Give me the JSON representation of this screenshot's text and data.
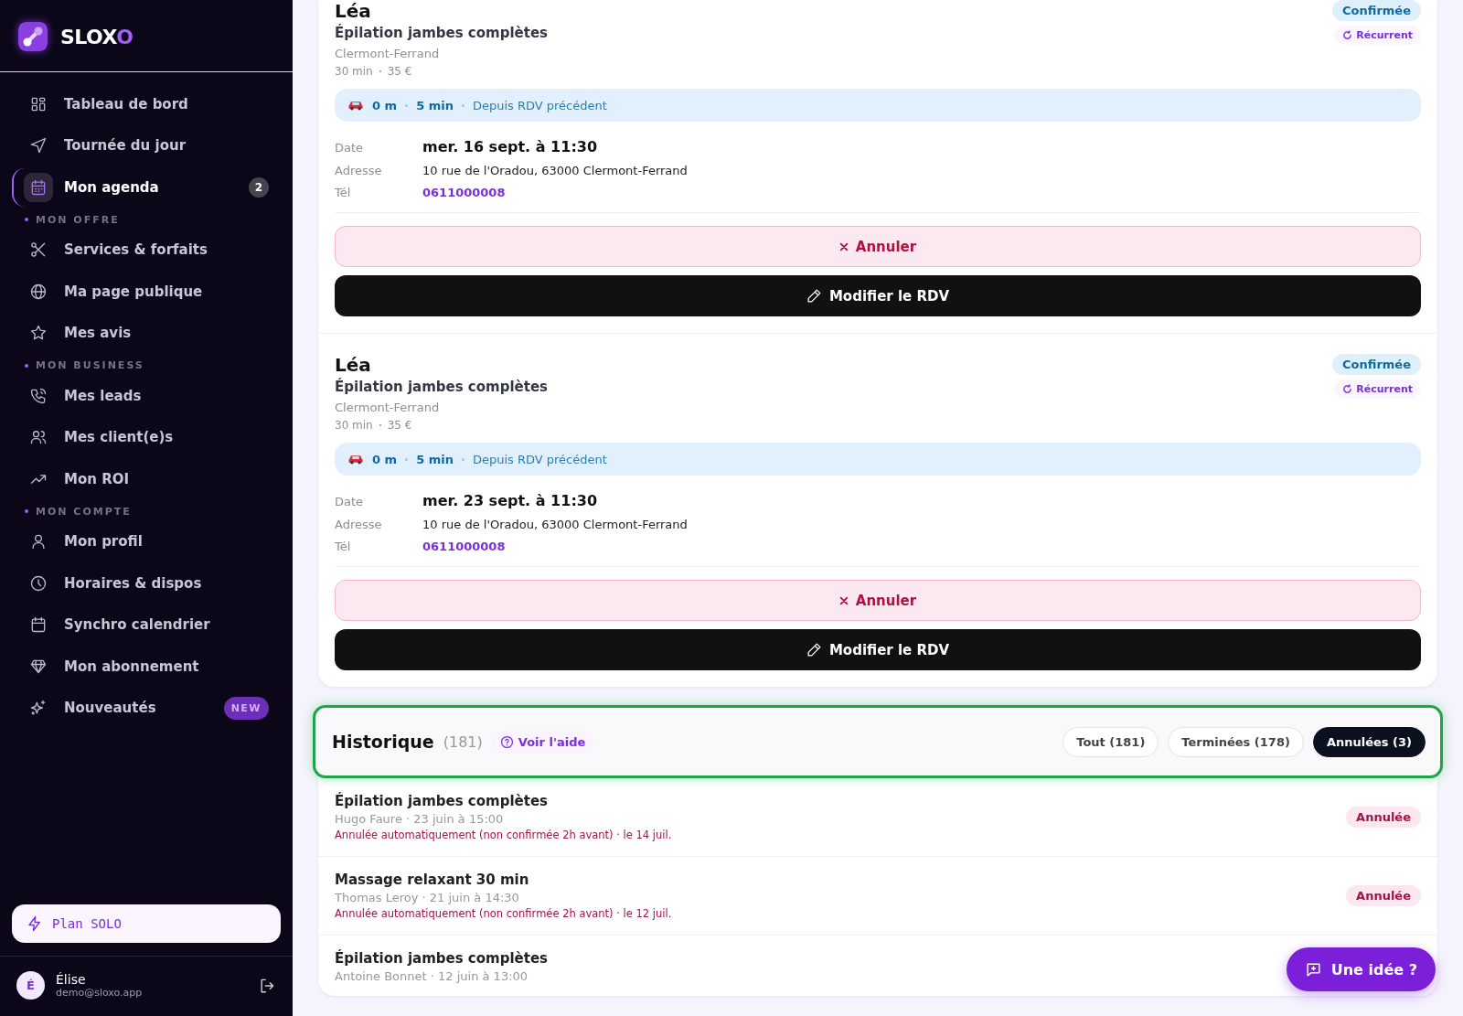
{
  "sidebar": {
    "logo": "SLOXO",
    "nav": [
      {
        "kind": "item",
        "label": "Tableau de bord",
        "selected": false
      },
      {
        "kind": "item",
        "label": "Tournée du jour",
        "selected": false
      },
      {
        "kind": "item",
        "label": "Mon agenda",
        "selected": true,
        "badge": "2"
      },
      {
        "kind": "section",
        "label": "MON OFFRE"
      },
      {
        "kind": "item",
        "label": "Services & forfaits",
        "selected": false
      },
      {
        "kind": "item",
        "label": "Ma page publique",
        "selected": false
      },
      {
        "kind": "item",
        "label": "Mes avis",
        "selected": false
      },
      {
        "kind": "section",
        "label": "MON BUSINESS"
      },
      {
        "kind": "item",
        "label": "Mes leads",
        "selected": false
      },
      {
        "kind": "item",
        "label": "Mes client(e)s",
        "selected": false
      },
      {
        "kind": "item",
        "label": "Mon ROI",
        "selected": false
      },
      {
        "kind": "section",
        "label": "MON COMPTE"
      },
      {
        "kind": "item",
        "label": "Mon profil",
        "selected": false
      },
      {
        "kind": "item",
        "label": "Horaires & dispos",
        "selected": false
      },
      {
        "kind": "item",
        "label": "Synchro calendrier",
        "selected": false
      },
      {
        "kind": "item",
        "label": "Mon abonnement",
        "selected": false
      },
      {
        "kind": "item",
        "label": "Nouveautés",
        "selected": false,
        "new_badge": "NEW"
      }
    ],
    "plan_button": "Plan SOLO",
    "user": {
      "initial": "É",
      "name": "Élise",
      "email": "demo@sloxo.app"
    }
  },
  "appointments": [
    {
      "client": "Léa",
      "service": "Épilation jambes complètes",
      "city": "Clermont-Ferrand",
      "duration": "30 min",
      "price": "35 €",
      "status": {
        "label": "Confirmée",
        "kind": "confirmed"
      },
      "tag": "Récurrent",
      "travel": {
        "distance": "0 m",
        "time": "5 min",
        "note": "Depuis RDV précédent"
      },
      "details": [
        {
          "label": "Date",
          "value": "mer. 16 sept. à 11:30",
          "kind": "date"
        },
        {
          "label": "Adresse",
          "value": "10 rue de l'Oradou, 63000 Clermont-Ferrand",
          "kind": "text"
        },
        {
          "label": "Tél",
          "value": "0611000008",
          "kind": "phone"
        }
      ],
      "actions": [
        {
          "label": "Annuler",
          "kind": "cancel"
        },
        {
          "label": "Modifier le RDV",
          "kind": "edit"
        }
      ]
    },
    {
      "client": "Léa",
      "service": "Épilation jambes complètes",
      "city": "Clermont-Ferrand",
      "duration": "30 min",
      "price": "35 €",
      "status": {
        "label": "Confirmée",
        "kind": "confirmed"
      },
      "tag": "Récurrent",
      "travel": {
        "distance": "0 m",
        "time": "5 min",
        "note": "Depuis RDV précédent"
      },
      "details": [
        {
          "label": "Date",
          "value": "mer. 23 sept. à 11:30",
          "kind": "date"
        },
        {
          "label": "Adresse",
          "value": "10 rue de l'Oradou, 63000 Clermont-Ferrand",
          "kind": "text"
        },
        {
          "label": "Tél",
          "value": "0611000008",
          "kind": "phone"
        }
      ],
      "actions": [
        {
          "label": "Annuler",
          "kind": "cancel"
        },
        {
          "label": "Modifier le RDV",
          "kind": "edit"
        }
      ]
    }
  ],
  "history": {
    "title": "Historique",
    "count": "(181)",
    "help": "Voir l'aide",
    "highlighted": true,
    "filters": [
      {
        "label": "Tout (181)",
        "selected": false
      },
      {
        "label": "Terminées (178)",
        "selected": false
      },
      {
        "label": "Annulées (3)",
        "selected": true
      }
    ],
    "rows": [
      {
        "title": "Épilation jambes complètes",
        "subtitle": "Hugo Faure · 23 juin à 15:00",
        "reason": "Annulée automatiquement (non confirmée 2h avant) · le 14 juil.",
        "status": {
          "label": "Annulée",
          "kind": "cancelled"
        }
      },
      {
        "title": "Massage relaxant 30 min",
        "subtitle": "Thomas Leroy · 21 juin à 14:30",
        "reason": "Annulée automatiquement (non confirmée 2h avant) · le 12 juil.",
        "status": {
          "label": "Annulée",
          "kind": "cancelled"
        }
      },
      {
        "title": "Épilation jambes complètes",
        "subtitle": "Antoine Bonnet · 12 juin à 13:00"
      }
    ]
  },
  "feedback_button": "Une idée ?"
}
